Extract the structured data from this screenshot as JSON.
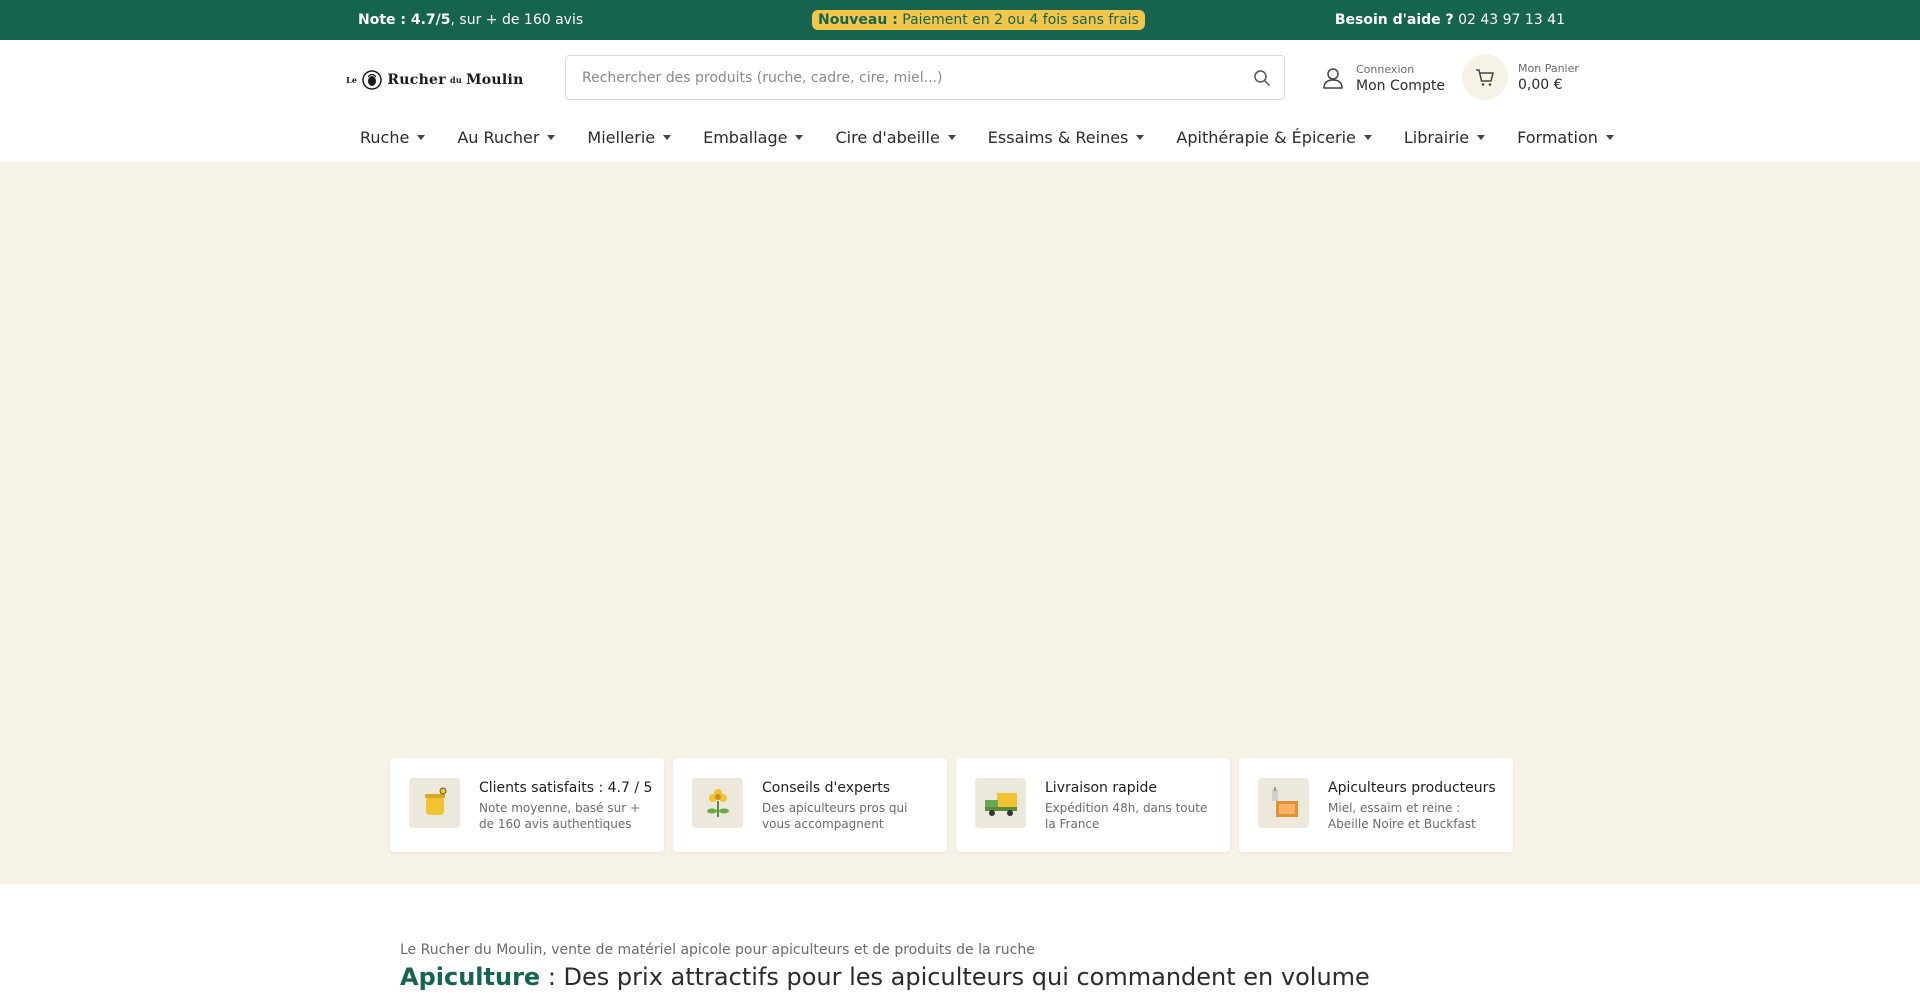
{
  "topbar": {
    "rating_glyph": "",
    "rating_strong": "Note : 4.7/5",
    "rating_rest": ", sur + de 160 avis",
    "promo_strong": "Nouveau :",
    "promo_rest": " Paiement en 2 ou 4 fois sans frais",
    "help_glyph": "",
    "help_strong": "Besoin d'aide ?",
    "help_phone": " 02 43 97 13 41"
  },
  "header": {
    "logo_text": "Rucher",
    "logo_prefix": "Le",
    "logo_mid": "du",
    "logo_suffix": "Moulin",
    "search_placeholder": "Rechercher des produits (ruche, cadre, cire, miel...)",
    "account_small": "Connexion",
    "account_big": "Mon Compte",
    "cart_small": "Mon Panier",
    "cart_total": "0,00 €"
  },
  "nav": {
    "items": [
      {
        "label": "Ruche"
      },
      {
        "label": "Au Rucher"
      },
      {
        "label": "Miellerie"
      },
      {
        "label": "Emballage"
      },
      {
        "label": "Cire d'abeille"
      },
      {
        "label": "Essaims & Reines"
      },
      {
        "label": "Apithérapie & Épicerie"
      },
      {
        "label": "Librairie"
      },
      {
        "label": "Formation"
      }
    ]
  },
  "features": [
    {
      "title": "Clients satisfaits : 4.7 / 5",
      "desc": "Note moyenne, basé sur + de 160 avis authentiques",
      "icon": "honey-jar-icon"
    },
    {
      "title": "Conseils d'experts",
      "desc": "Des apiculteurs pros qui vous accompagnent",
      "icon": "flower-icon"
    },
    {
      "title": "Livraison rapide",
      "desc": "Expédition 48h, dans toute la France",
      "icon": "delivery-truck-icon"
    },
    {
      "title": "Apiculteurs producteurs",
      "desc": "Miel, essaim et reine : Abeille Noire et Buckfast",
      "icon": "honey-frame-icon"
    }
  ],
  "intro": {
    "subtitle": "Le Rucher du Moulin, vente de matériel apicole pour apiculteurs et de produits de la ruche",
    "title_strong": "Apiculture",
    "title_rest": " : Des prix attractifs pour les apiculteurs qui commandent en volume ",
    "title_glyph": ""
  },
  "colors": {
    "brand_green": "#16634f",
    "accent_yellow": "#f4c64a",
    "hero_bg": "#f6f2e6"
  }
}
